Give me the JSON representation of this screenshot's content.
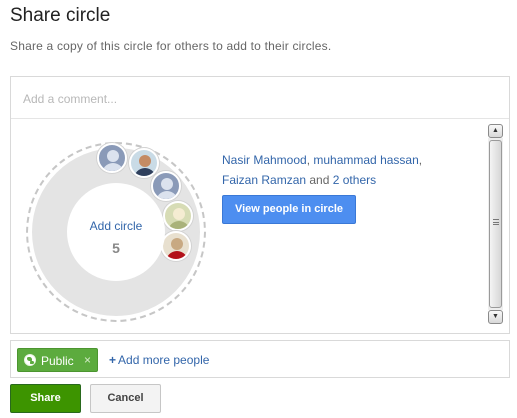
{
  "dialog": {
    "title": "Share circle",
    "subtitle": "Share a copy of this circle for others to add to their circles."
  },
  "comment": {
    "placeholder": "Add a comment..."
  },
  "circle": {
    "center_label": "Add circle",
    "count": "5",
    "avatars": [
      {
        "name": "person-icon",
        "kind": "placeholder"
      },
      {
        "name": "photo",
        "kind": "photo"
      },
      {
        "name": "person-icon",
        "kind": "placeholder"
      },
      {
        "name": "photo",
        "kind": "photo"
      },
      {
        "name": "photo",
        "kind": "photo"
      }
    ]
  },
  "people": {
    "names": [
      "Nasir Mahmood",
      "muhammad hassan",
      "Faizan Ramzan"
    ],
    "sep1": ", ",
    "sep2": ",",
    "and_text": " and ",
    "others_link": "2 others"
  },
  "view_button": "View people in circle",
  "scrollbar": {
    "up_icon": "▲",
    "down_icon": "▼"
  },
  "share_row": {
    "chip_label": "Public",
    "chip_close": "×",
    "add_more_plus": "+",
    "add_more": "Add more people"
  },
  "buttons": {
    "share": "Share",
    "cancel": "Cancel"
  },
  "colors": {
    "link": "#3366aa",
    "view_button": "#4d8ef0",
    "public_chip": "#5cab3e",
    "share_button": "#3d9400"
  }
}
